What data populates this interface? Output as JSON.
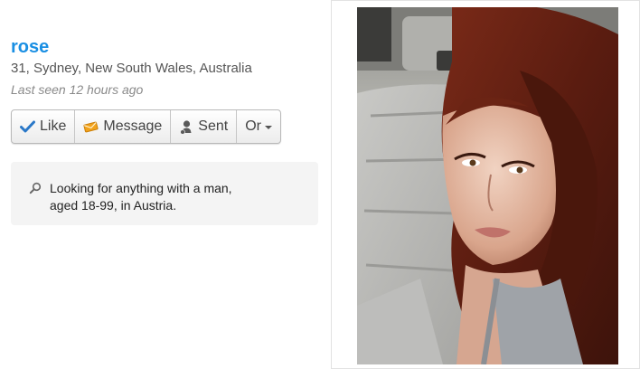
{
  "profile": {
    "name": "rose",
    "location": "31, Sydney, New South Wales, Australia",
    "last_seen": "Last seen 12 hours ago"
  },
  "actions": {
    "like_label": "Like",
    "message_label": "Message",
    "sent_label": "Sent",
    "more_label": "Or"
  },
  "looking_for": {
    "line1": "Looking for anything with a man,",
    "line2": "aged 18-99, in Austria."
  },
  "icons": {
    "like": "checkmark-icon",
    "message": "envelope-icon",
    "sent": "person-sent-icon",
    "more": "chevron-down-icon",
    "search": "magnifier-icon"
  },
  "colors": {
    "name_link": "#1a8fe3",
    "check_blue": "#2a78c8",
    "envelope_orange": "#f2a21b"
  }
}
